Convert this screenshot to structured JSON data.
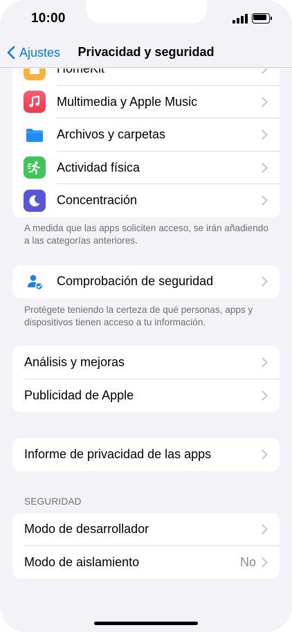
{
  "status_bar": {
    "time": "10:00"
  },
  "nav": {
    "back_label": "Ajustes",
    "title": "Privacidad y seguridad"
  },
  "apps_group": {
    "items": [
      {
        "label": "HomeKit",
        "icon": "homekit-icon",
        "color": "#f7b23b"
      },
      {
        "label": "Multimedia y Apple Music",
        "icon": "music-note-icon",
        "color": "#f2394b"
      },
      {
        "label": "Archivos y carpetas",
        "icon": "folder-icon",
        "color": "#1e8ef5"
      },
      {
        "label": "Actividad física",
        "icon": "running-figure-icon",
        "color": "#3dc75a"
      },
      {
        "label": "Concentración",
        "icon": "moon-icon",
        "color": "#5856d6"
      }
    ],
    "footer": "A medida que las apps soliciten acceso, se irán añadiendo a las categorías anteriores."
  },
  "safety_group": {
    "item": {
      "label": "Comprobación de seguridad",
      "icon": "person-check-icon",
      "color": "#1e7cf2"
    },
    "footer": "Protégete teniendo la certeza de qué personas, apps y dispositivos tienen acceso a tu información."
  },
  "analytics_group": {
    "items": [
      {
        "label": "Análisis y mejoras"
      },
      {
        "label": "Publicidad de Apple"
      }
    ]
  },
  "report_group": {
    "item": {
      "label": "Informe de privacidad de las apps"
    }
  },
  "security_section": {
    "header": "SEGURIDAD",
    "items": [
      {
        "label": "Modo de desarrollador"
      },
      {
        "label": "Modo de aislamiento",
        "value": "No"
      }
    ]
  },
  "colors": {
    "accent": "#007aff",
    "background": "#f2f2f7",
    "chevron": "#c4c4c7",
    "secondary_text": "#6d6d72"
  }
}
